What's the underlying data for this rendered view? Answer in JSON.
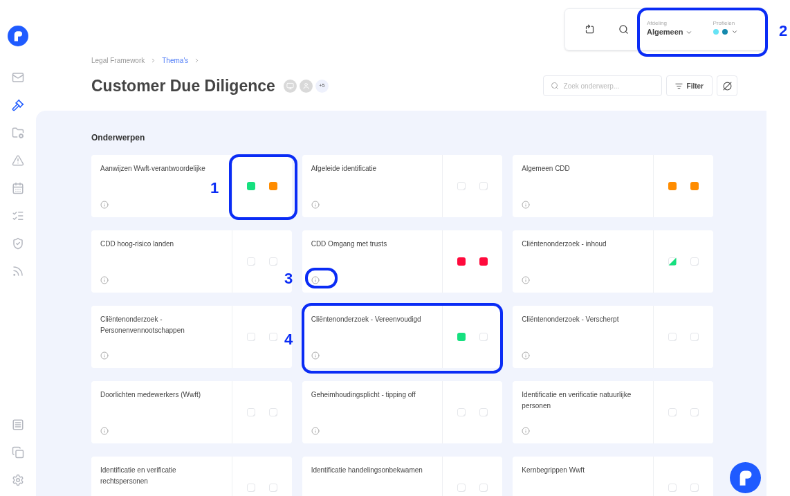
{
  "sidebar": {
    "items": [
      {
        "selected": false
      },
      {
        "selected": true
      },
      {
        "selected": false
      },
      {
        "selected": false
      },
      {
        "selected": false
      },
      {
        "selected": false
      },
      {
        "selected": false
      },
      {
        "selected": false
      }
    ],
    "bottom_items": [
      {
        "selected": false
      },
      {
        "selected": false
      },
      {
        "selected": false
      }
    ]
  },
  "topbar": {
    "department": {
      "label": "Afdeling",
      "value": "Algemeen"
    },
    "profiles": {
      "label": "Profielen",
      "dots": [
        {
          "color": "#67e3f5"
        },
        {
          "color": "#1589ad"
        }
      ]
    }
  },
  "breadcrumb": [
    {
      "label": "Legal Framework",
      "current": false
    },
    {
      "label": "Thema's",
      "current": true
    }
  ],
  "title": "Customer Due Diligence",
  "members_more": "+5",
  "search": {
    "placeholder": "Zoek onderwerp..."
  },
  "filter_button": "Filter",
  "section_title": "Onderwerpen",
  "topics": [
    {
      "title": "Aanwijzen Wwft-verantwoordelijke",
      "status": [
        {
          "kind": "filled",
          "color": "#16e07f"
        },
        {
          "kind": "filled",
          "color": "#ff8c00"
        }
      ]
    },
    {
      "title": "Afgeleide identificatie",
      "status": [
        {
          "kind": "empty"
        },
        {
          "kind": "empty"
        }
      ]
    },
    {
      "title": "Algemeen CDD",
      "status": [
        {
          "kind": "filled",
          "color": "#ff8c00"
        },
        {
          "kind": "filled",
          "color": "#ff8c00"
        }
      ]
    },
    {
      "title": "CDD hoog-risico landen",
      "status": [
        {
          "kind": "empty"
        },
        {
          "kind": "empty"
        }
      ]
    },
    {
      "title": "CDD Omgang met trusts",
      "status": [
        {
          "kind": "filled",
          "color": "#ff0a3c"
        },
        {
          "kind": "filled",
          "color": "#ff0a3c"
        }
      ]
    },
    {
      "title": "Cliëntenonderzoek - inhoud",
      "status": [
        {
          "kind": "partial",
          "color": "#16e07f"
        },
        {
          "kind": "empty"
        }
      ]
    },
    {
      "title": "Cliëntenonderzoek - Personenvennootschappen",
      "status": [
        {
          "kind": "empty"
        },
        {
          "kind": "empty"
        }
      ]
    },
    {
      "title": "Cliëntenonderzoek - Vereenvoudigd",
      "status": [
        {
          "kind": "filled",
          "color": "#16e07f"
        },
        {
          "kind": "empty"
        }
      ]
    },
    {
      "title": "Cliëntenonderzoek - Verscherpt",
      "status": [
        {
          "kind": "empty"
        },
        {
          "kind": "empty"
        }
      ]
    },
    {
      "title": "Doorlichten medewerkers (Wwft)",
      "status": [
        {
          "kind": "empty"
        },
        {
          "kind": "empty"
        }
      ]
    },
    {
      "title": "Geheimhoudingsplicht - tipping off",
      "status": [
        {
          "kind": "empty"
        },
        {
          "kind": "empty"
        }
      ]
    },
    {
      "title": "Identificatie en verificatie natuurlijke personen",
      "status": [
        {
          "kind": "empty"
        },
        {
          "kind": "empty"
        }
      ]
    },
    {
      "title": "Identificatie en verificatie rechtspersonen",
      "status": [
        {
          "kind": "empty"
        },
        {
          "kind": "empty"
        }
      ]
    },
    {
      "title": "Identificatie handelingsonbekwamen",
      "status": [
        {
          "kind": "empty"
        },
        {
          "kind": "empty"
        }
      ]
    },
    {
      "title": "Kernbegrippen Wwft",
      "status": [
        {
          "kind": "empty"
        },
        {
          "kind": "empty"
        }
      ]
    }
  ],
  "annotations": [
    {
      "label": "1"
    },
    {
      "label": "2"
    },
    {
      "label": "3"
    },
    {
      "label": "4"
    }
  ]
}
